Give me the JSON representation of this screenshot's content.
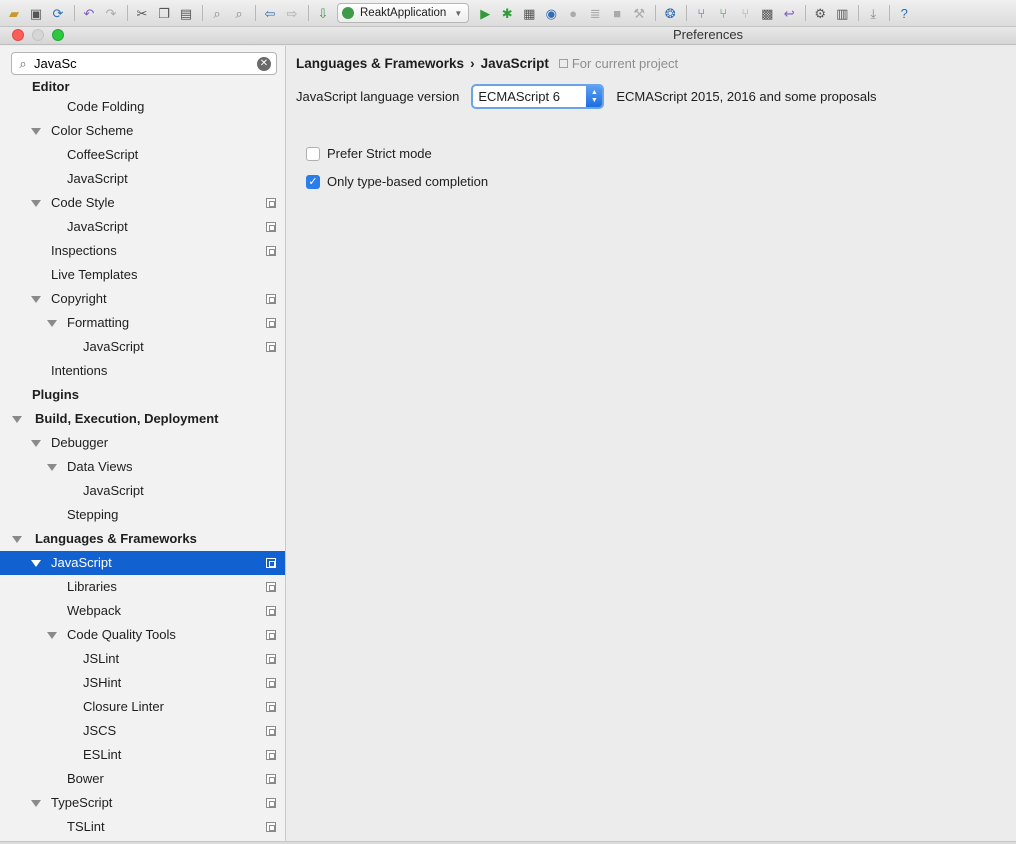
{
  "toolbar": {
    "icons": [
      "open-folder-icon",
      "save-icon",
      "sync-icon",
      "undo-icon",
      "redo-icon",
      "cut-icon",
      "copy-icon",
      "paste-icon",
      "find-icon",
      "replace-icon",
      "back-icon",
      "forward-icon",
      "make-icon"
    ],
    "run_config": "ReaktApplication",
    "right_icons": [
      "run-icon",
      "debug-icon",
      "coverage-icon",
      "profile-icon",
      "attach-icon",
      "stop-icon",
      "build-icon",
      "help-icon",
      "vcs-update-icon",
      "vcs-commit-icon",
      "vcs-compare-icon",
      "vcs-history-icon",
      "vcs-revert-icon",
      "settings-icon",
      "project-structure-icon",
      "sdk-icon",
      "question-icon"
    ]
  },
  "window": {
    "title": "Preferences"
  },
  "search": {
    "value": "JavaSc"
  },
  "tree": [
    {
      "label": "Editor",
      "level": 0,
      "bold": true,
      "arrow": false,
      "proj": false
    },
    {
      "label": "Code Folding",
      "level": 2,
      "bold": false,
      "arrow": false,
      "proj": false
    },
    {
      "label": "Color Scheme",
      "level": 1,
      "bold": false,
      "arrow": true,
      "proj": false
    },
    {
      "label": "CoffeeScript",
      "level": 2,
      "bold": false,
      "arrow": false,
      "proj": false
    },
    {
      "label": "JavaScript",
      "level": 2,
      "bold": false,
      "arrow": false,
      "proj": false
    },
    {
      "label": "Code Style",
      "level": 1,
      "bold": false,
      "arrow": true,
      "proj": true
    },
    {
      "label": "JavaScript",
      "level": 2,
      "bold": false,
      "arrow": false,
      "proj": true
    },
    {
      "label": "Inspections",
      "level": 1,
      "bold": false,
      "arrow": false,
      "proj": true
    },
    {
      "label": "Live Templates",
      "level": 1,
      "bold": false,
      "arrow": false,
      "proj": false
    },
    {
      "label": "Copyright",
      "level": 1,
      "bold": false,
      "arrow": true,
      "proj": true
    },
    {
      "label": "Formatting",
      "level": 2,
      "bold": false,
      "arrow": true,
      "proj": true
    },
    {
      "label": "JavaScript",
      "level": 3,
      "bold": false,
      "arrow": false,
      "proj": true
    },
    {
      "label": "Intentions",
      "level": 1,
      "bold": false,
      "arrow": false,
      "proj": false
    },
    {
      "label": "Plugins",
      "level": 0,
      "bold": true,
      "arrow": false,
      "proj": false
    },
    {
      "label": "Build, Execution, Deployment",
      "level": 0,
      "bold": true,
      "arrow": true,
      "proj": false
    },
    {
      "label": "Debugger",
      "level": 1,
      "bold": false,
      "arrow": true,
      "proj": false
    },
    {
      "label": "Data Views",
      "level": 2,
      "bold": false,
      "arrow": true,
      "proj": false
    },
    {
      "label": "JavaScript",
      "level": 3,
      "bold": false,
      "arrow": false,
      "proj": false
    },
    {
      "label": "Stepping",
      "level": 2,
      "bold": false,
      "arrow": false,
      "proj": false
    },
    {
      "label": "Languages & Frameworks",
      "level": 0,
      "bold": true,
      "arrow": true,
      "proj": false
    },
    {
      "label": "JavaScript",
      "level": 1,
      "bold": false,
      "arrow": true,
      "proj": true,
      "selected": true
    },
    {
      "label": "Libraries",
      "level": 2,
      "bold": false,
      "arrow": false,
      "proj": true
    },
    {
      "label": "Webpack",
      "level": 2,
      "bold": false,
      "arrow": false,
      "proj": true
    },
    {
      "label": "Code Quality Tools",
      "level": 2,
      "bold": false,
      "arrow": true,
      "proj": true
    },
    {
      "label": "JSLint",
      "level": 3,
      "bold": false,
      "arrow": false,
      "proj": true
    },
    {
      "label": "JSHint",
      "level": 3,
      "bold": false,
      "arrow": false,
      "proj": true
    },
    {
      "label": "Closure Linter",
      "level": 3,
      "bold": false,
      "arrow": false,
      "proj": true
    },
    {
      "label": "JSCS",
      "level": 3,
      "bold": false,
      "arrow": false,
      "proj": true
    },
    {
      "label": "ESLint",
      "level": 3,
      "bold": false,
      "arrow": false,
      "proj": true
    },
    {
      "label": "Bower",
      "level": 2,
      "bold": false,
      "arrow": false,
      "proj": true
    },
    {
      "label": "TypeScript",
      "level": 1,
      "bold": false,
      "arrow": true,
      "proj": true
    },
    {
      "label": "TSLint",
      "level": 2,
      "bold": false,
      "arrow": false,
      "proj": true
    }
  ],
  "content": {
    "breadcrumb_parent": "Languages & Frameworks",
    "breadcrumb_sep": "›",
    "breadcrumb_current": "JavaScript",
    "scope": "For current project",
    "lang_label": "JavaScript language version",
    "lang_value": "ECMAScript 6",
    "lang_desc": "ECMAScript 2015, 2016 and some proposals",
    "strict_label": "Prefer Strict mode",
    "strict_checked": false,
    "typecomp_label": "Only type-based completion",
    "typecomp_checked": true
  },
  "colors": {
    "selection": "#1162d0",
    "accent": "#2b7de9"
  }
}
